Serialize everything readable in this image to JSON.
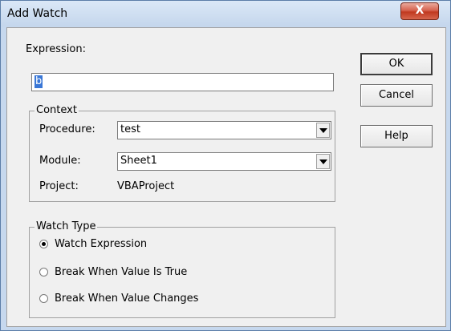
{
  "window": {
    "title": "Add Watch",
    "close_glyph": "X"
  },
  "expression": {
    "label": "Expression:",
    "value": "b"
  },
  "context": {
    "legend": "Context",
    "procedure_label": "Procedure:",
    "procedure_value": "test",
    "module_label": "Module:",
    "module_value": "Sheet1",
    "project_label": "Project:",
    "project_value": "VBAProject"
  },
  "watch_type": {
    "legend": "Watch Type",
    "options": [
      {
        "label": "Watch Expression",
        "selected": true
      },
      {
        "label": "Break When Value Is True",
        "selected": false
      },
      {
        "label": "Break When Value Changes",
        "selected": false
      }
    ]
  },
  "buttons": {
    "ok": "OK",
    "cancel": "Cancel",
    "help": "Help"
  }
}
